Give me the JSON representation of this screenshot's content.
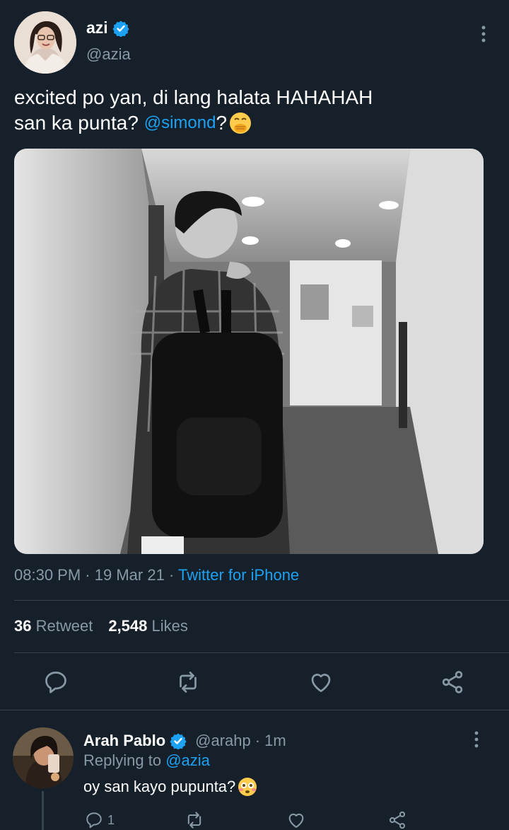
{
  "tweet": {
    "author_name": "azi",
    "author_handle": "@azia",
    "text_line1": "excited po yan, di lang halata HAHAHAH",
    "text_line2_prefix": "san ka punta? ",
    "mention": "@simond",
    "text_line2_suffix": "?",
    "emoji_icon": "face-with-hand-over-mouth-icon",
    "time": "08:30 PM",
    "date": "19 Mar 21",
    "source": "Twitter for iPhone",
    "retweets_count": "36",
    "retweets_label": "Retweet",
    "likes_count": "2,548",
    "likes_label": "Likes"
  },
  "reply": {
    "author_name": "Arah Pablo",
    "author_handle": "@arahp",
    "time_ago": "1m",
    "replying_prefix": "Replying to ",
    "replying_to": "@azia",
    "text": "oy san kayo pupunta?",
    "emoji_icon": "flushed-face-icon",
    "reply_count": "1"
  },
  "colors": {
    "background": "#15202b",
    "accent": "#1da1f2",
    "secondary_text": "#8899a6",
    "divider": "#38444d"
  }
}
